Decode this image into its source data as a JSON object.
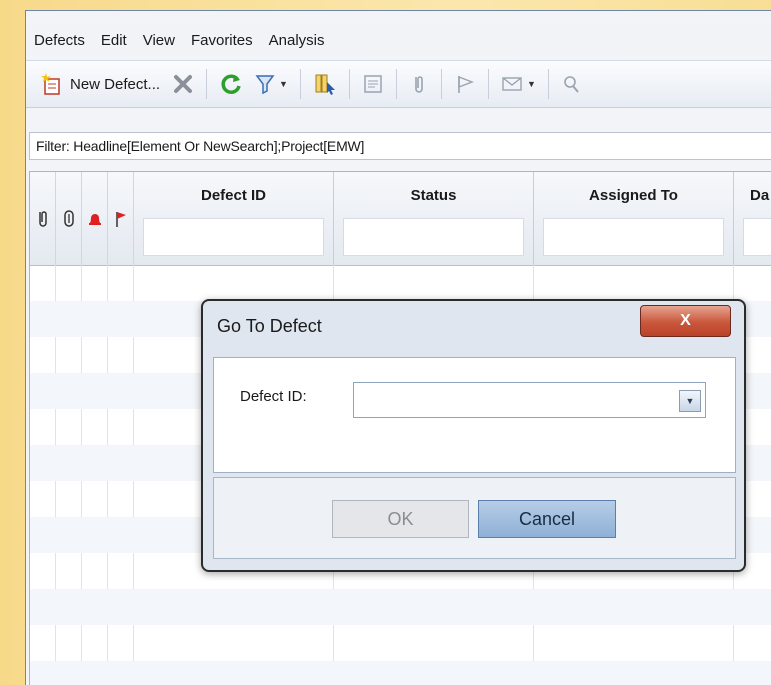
{
  "menu": [
    "Defects",
    "Edit",
    "View",
    "Favorites",
    "Analysis"
  ],
  "toolbar": {
    "new_defect_label": "New Defect..."
  },
  "filter": {
    "text": "Filter: Headline[Element Or NewSearch];Project[EMW]"
  },
  "grid": {
    "columns": [
      "Defect ID",
      "Status",
      "Assigned To",
      "Da"
    ]
  },
  "dialog": {
    "title": "Go To Defect",
    "close_label": "X",
    "field_label": "Defect ID:",
    "field_value": "",
    "ok_label": "OK",
    "cancel_label": "Cancel"
  },
  "colors": {
    "background": "#f8de95",
    "close_button": "#c9573b",
    "cancel_button": "#8fb0d6"
  }
}
